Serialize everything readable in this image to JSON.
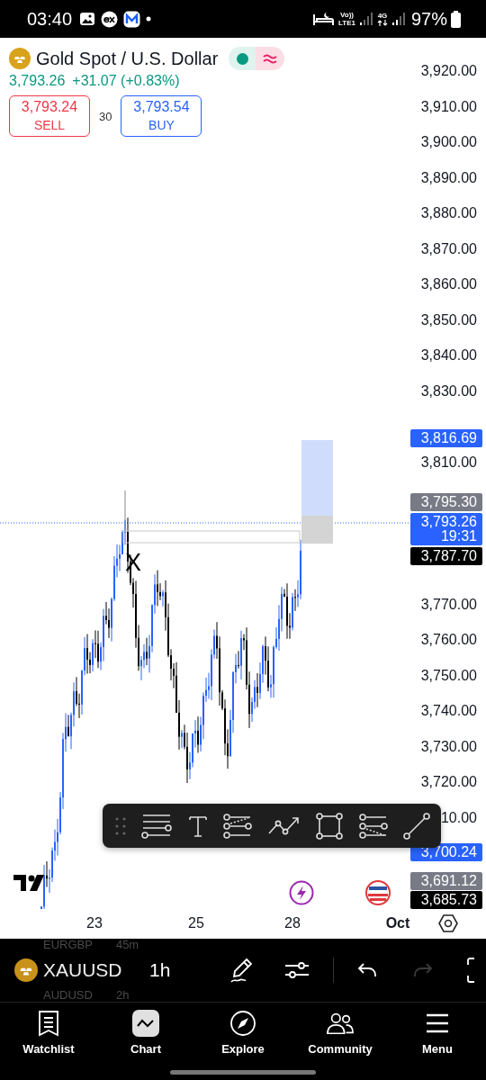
{
  "status_bar": {
    "time": "03:40",
    "network_labels": [
      "Vo))",
      "LTE1"
    ],
    "data_label": "4G",
    "battery": "97%"
  },
  "header": {
    "title": "Gold Spot / U.S. Dollar",
    "market_open": true,
    "last_price": "3,793.26",
    "change": "+31.07 (+0.83%)",
    "sell": {
      "price": "3,793.24",
      "label": "SELL"
    },
    "spread": "30",
    "buy": {
      "price": "3,793.54",
      "label": "BUY"
    }
  },
  "chart": {
    "price_axis": [
      "3,920.00",
      "3,910.00",
      "3,900.00",
      "3,890.00",
      "3,880.00",
      "3,870.00",
      "3,860.00",
      "3,850.00",
      "3,840.00",
      "3,830.00",
      "3,810.00",
      "3,770.00",
      "3,760.00",
      "3,750.00",
      "3,740.00",
      "3,730.00",
      "3,720.00",
      "10.00"
    ],
    "price_tags": [
      {
        "price": "3,816.69",
        "color": "#2962ff"
      },
      {
        "price": "3,795.30",
        "color": "#787b86"
      },
      {
        "price": "3,793.26",
        "countdown": "19:31",
        "color": "#2962ff"
      },
      {
        "price": "3,787.70",
        "color": "#000000"
      },
      {
        "price": "3,700.24",
        "color": "#2962ff"
      },
      {
        "price": "3,691.12",
        "color": "#787b86"
      },
      {
        "price": "3,685.73",
        "color": "#000000"
      }
    ],
    "marker": "X",
    "date_axis": [
      {
        "label": "23",
        "bold": false
      },
      {
        "label": "25",
        "bold": false
      },
      {
        "label": "28",
        "bold": false
      },
      {
        "label": "Oct",
        "bold": true
      }
    ]
  },
  "symbol_bar": {
    "picker_above": [
      "EURGBP",
      "45m"
    ],
    "symbol": "XAUUSD",
    "interval": "1h",
    "picker_below": [
      "AUDUSD",
      "2h"
    ],
    "redo_disabled": true
  },
  "nav": [
    {
      "label": "Watchlist",
      "selected": false
    },
    {
      "label": "Chart",
      "selected": true
    },
    {
      "label": "Explore",
      "selected": false
    },
    {
      "label": "Community",
      "selected": false
    },
    {
      "label": "Menu",
      "selected": false
    }
  ]
}
